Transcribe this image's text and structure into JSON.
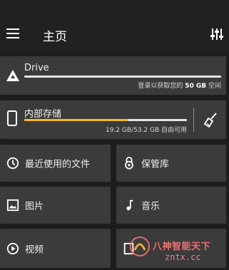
{
  "appbar": {
    "title": "主页",
    "menu_icon": "menu-icon",
    "settings_icon": "tune-icon"
  },
  "drive": {
    "label": "Drive",
    "sub_prefix": "登录以获取您的 ",
    "sub_bold": "50 GB",
    "sub_suffix": " 空间",
    "icon": "google-drive-icon"
  },
  "internal": {
    "label": "内部存储",
    "used": "19.2 GB",
    "total": "53.2 GB",
    "sub_text": "19.2 GB/53.2 GB 自由可用",
    "progress": 0.64,
    "icon": "phone-icon",
    "cleanup_icon": "broom-icon"
  },
  "tiles": [
    {
      "label": "最近使用的文件",
      "icon": "clock-icon"
    },
    {
      "label": "保管库",
      "icon": "vault-icon"
    },
    {
      "label": "图片",
      "icon": "image-icon"
    },
    {
      "label": "音乐",
      "icon": "music-note-icon"
    },
    {
      "label": "视频",
      "icon": "play-circle-icon"
    },
    {
      "label": "",
      "icon": "document-icon"
    }
  ],
  "watermark": {
    "line1": "八神智能天下",
    "line2": "zntx.cc"
  },
  "colors": {
    "accent": "#f2b928",
    "background": "#1d1d1d",
    "card": "#3b3b3b"
  }
}
